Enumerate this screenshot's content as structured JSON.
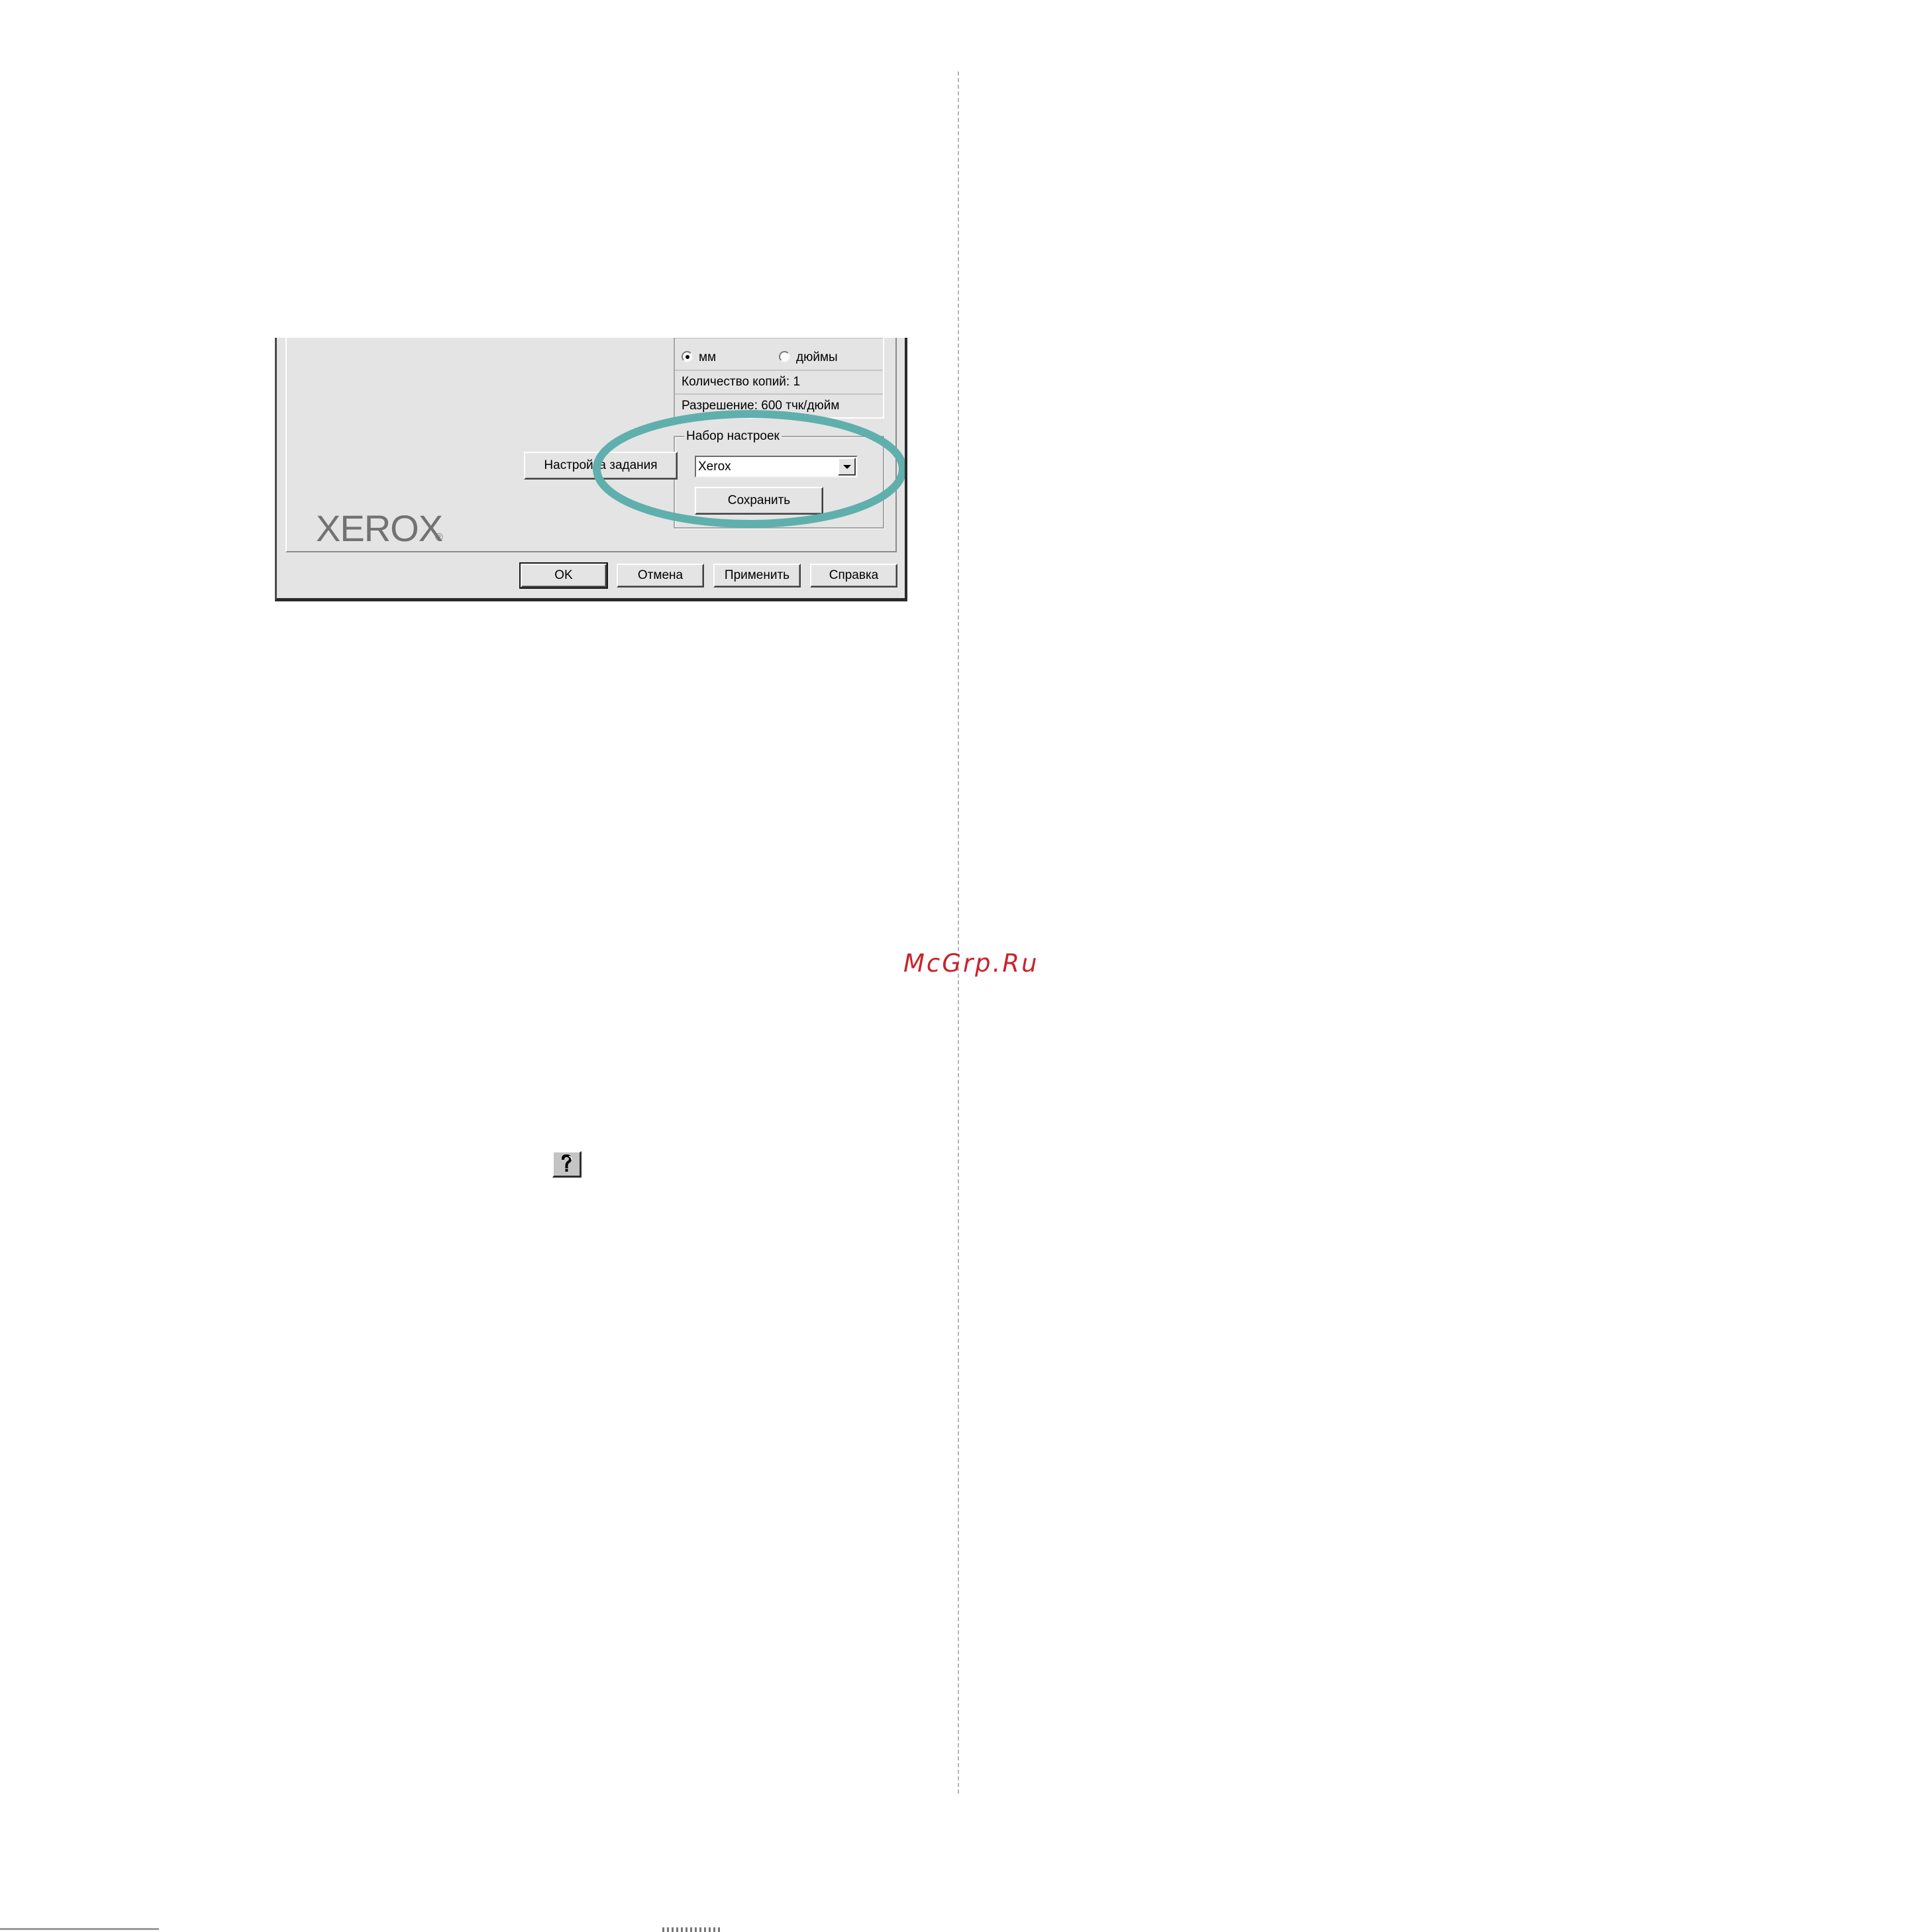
{
  "watermark": "McGrp.Ru",
  "dialog": {
    "summary": {
      "unit_mm_label": "мм",
      "unit_inch_label": "дюймы",
      "copies_text": "Количество копий: 1",
      "resolution_text": "Разрешение: 600 тчк/дюйм",
      "selected_unit": "мм"
    },
    "job_settings_button": "Настройка задания",
    "favorites": {
      "group_label": "Набор настроек",
      "selected_value": "Xerox",
      "save_button": "Сохранить"
    },
    "logo": "XEROX",
    "logo_mark": "®",
    "buttons": {
      "ok": "OK",
      "cancel": "Отмена",
      "apply": "Применить",
      "help": "Справка"
    },
    "highlight_color": "#5fafad"
  },
  "help_button_icon": "question-mark-icon"
}
